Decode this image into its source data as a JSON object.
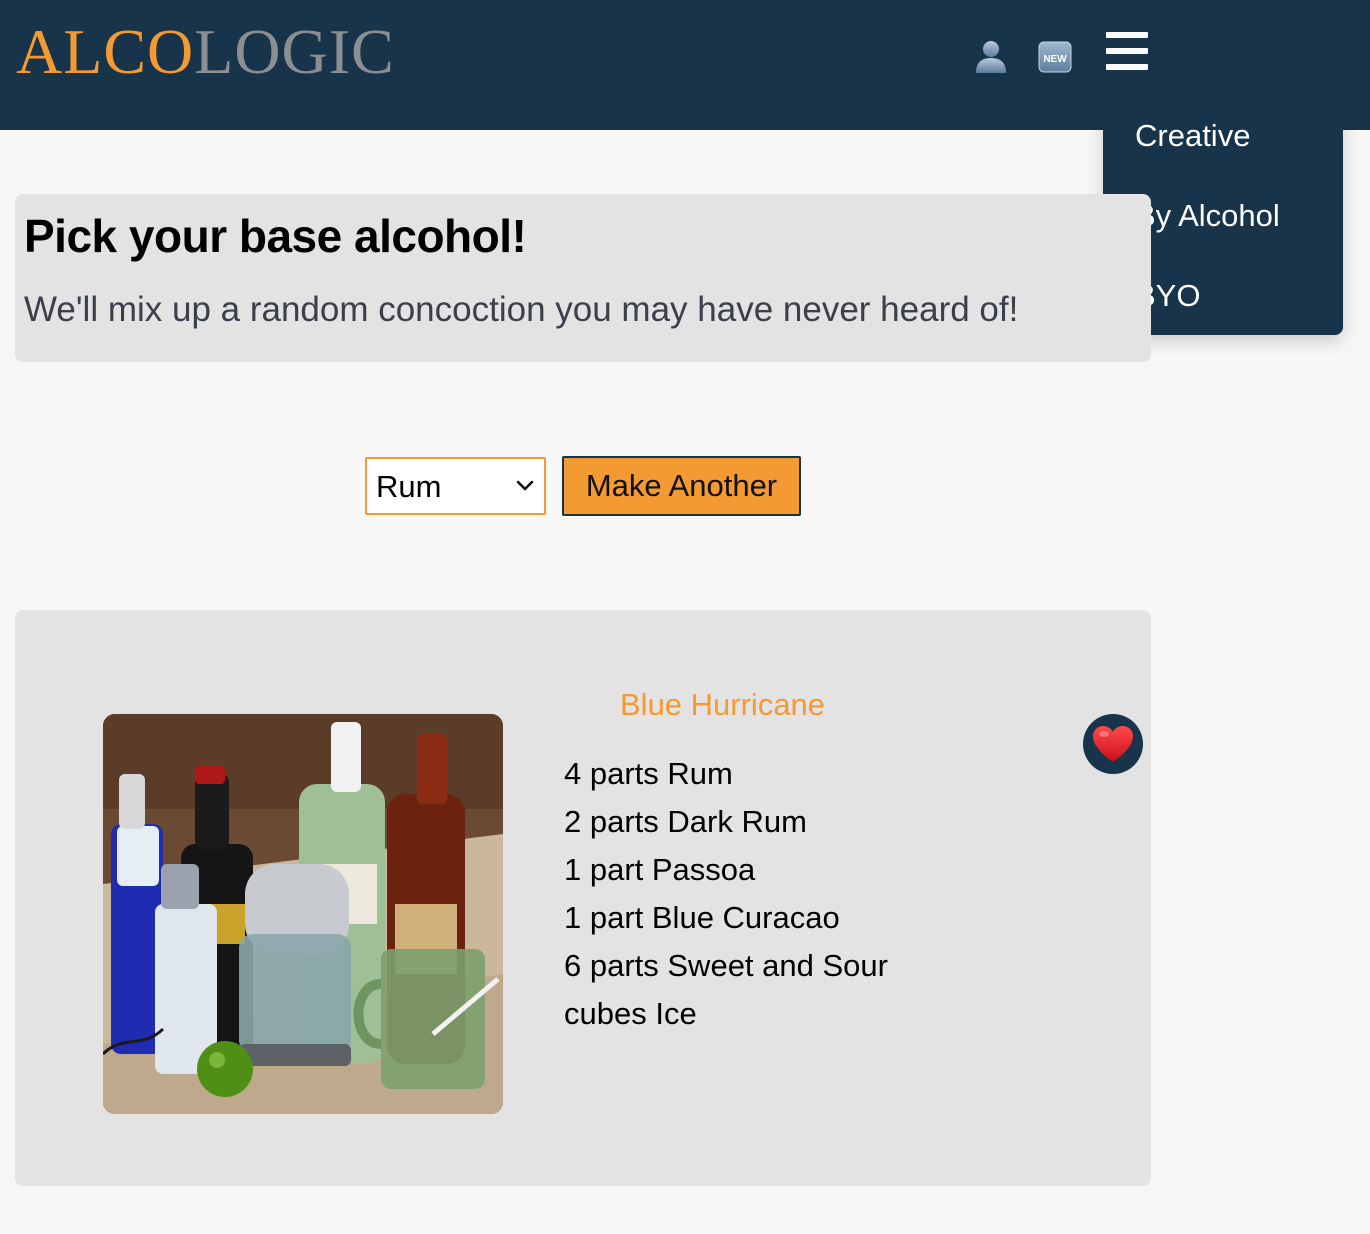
{
  "brand": {
    "part1": "ALCO",
    "part2": "LOGIC"
  },
  "nav": {
    "icons": [
      "user-icon",
      "new-badge-icon",
      "hamburger-menu-icon"
    ],
    "new_badge_label": "NEW",
    "menu_items": [
      {
        "label": "Creative"
      },
      {
        "label": "By Alcohol"
      },
      {
        "label": "BYO"
      }
    ]
  },
  "hero": {
    "title": "Pick your base alcohol!",
    "subtitle": "We'll mix up a random concoction you may have never heard of!"
  },
  "controls": {
    "alcohol_select": {
      "value": "Rum"
    },
    "make_another_label": "Make Another"
  },
  "recipe": {
    "name": "Blue Hurricane",
    "ingredients": [
      "4 parts Rum",
      "2 parts Dark Rum",
      "1 part Passoa",
      "1 part Blue Curacao",
      "6 parts Sweet and Sour",
      "cubes Ice"
    ],
    "favorite_icon": "heart-icon"
  },
  "colors": {
    "navy": "#17344b",
    "orange": "#f39a32",
    "gray_logo": "#8b8e92",
    "panel": "#e3e3e3",
    "background": "#f7f7f5"
  }
}
